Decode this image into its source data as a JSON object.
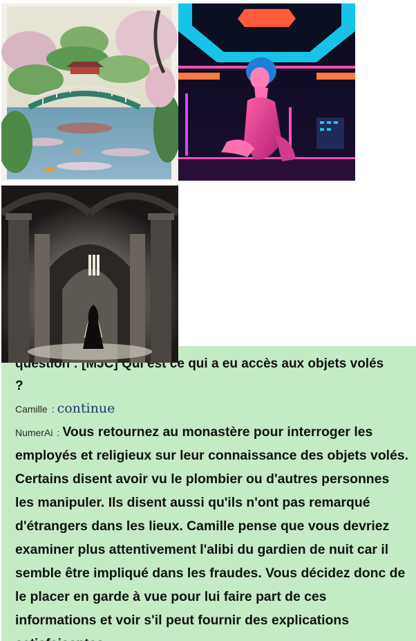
{
  "chat": {
    "clipped_line": "question : [MJC] Qui est ce qui a eu accès aux objets volés",
    "clipped_tail": "?",
    "messages": [
      {
        "speaker": "Camille",
        "separator": ":",
        "text": "continue"
      },
      {
        "speaker": "NumerAi",
        "separator": ":",
        "text": "Vous retournez au monastère pour interroger les employés et religieux sur leur connaissance des objets volés. Certains disent avoir vu le plombier ou d'autres personnes les manipuler. Ils disent aussi qu'ils n'ont pas remarqué d'étrangers dans les lieux. Camille pense que vous devriez examiner plus attentivement l'alibi du gardien de nuit car il semble être impliqué dans les fraudes. Vous décidez donc de le placer en garde à vue pour lui faire part de ces informations et voir s'il peut fournir des explications satisfaisantes."
      }
    ]
  },
  "gallery": {
    "images": [
      {
        "subject": "japanese-garden-painting"
      },
      {
        "subject": "neon-synthwave-woman"
      },
      {
        "subject": "monastery-hooded-figure"
      }
    ]
  },
  "colors": {
    "chat_background": "#c4eac6",
    "ai_text": "#111111",
    "user_text": "#1f3a66",
    "speaker_label": "#2a2a2a"
  }
}
